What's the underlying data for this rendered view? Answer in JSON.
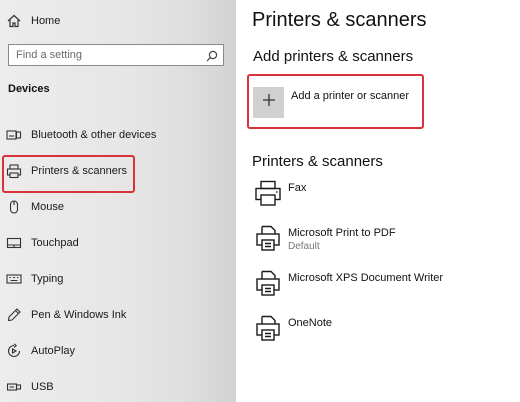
{
  "nav": {
    "home_label": "Home",
    "search_placeholder": "Find a setting",
    "section_label": "Devices",
    "items": [
      {
        "label": "Bluetooth & other devices",
        "icon": "bluetooth-devices-icon"
      },
      {
        "label": "Printers & scanners",
        "icon": "printer-icon",
        "selected": true
      },
      {
        "label": "Mouse",
        "icon": "mouse-icon"
      },
      {
        "label": "Touchpad",
        "icon": "touchpad-icon"
      },
      {
        "label": "Typing",
        "icon": "keyboard-icon"
      },
      {
        "label": "Pen & Windows Ink",
        "icon": "pen-icon"
      },
      {
        "label": "AutoPlay",
        "icon": "autoplay-icon"
      },
      {
        "label": "USB",
        "icon": "usb-icon"
      }
    ]
  },
  "main": {
    "title": "Printers & scanners",
    "add_section_title": "Add printers & scanners",
    "add_button_label": "Add a printer or scanner",
    "list_section_title": "Printers & scanners",
    "printers": [
      {
        "name": "Fax",
        "status": "",
        "icon": "fax-printer-icon"
      },
      {
        "name": "Microsoft Print to PDF",
        "status": "Default",
        "icon": "printer-icon"
      },
      {
        "name": "Microsoft XPS Document Writer",
        "status": "",
        "icon": "printer-icon"
      },
      {
        "name": "OneNote",
        "status": "",
        "icon": "printer-icon"
      }
    ]
  },
  "colors": {
    "highlight": "#d9323a",
    "add_tile": "#d0d0d0"
  }
}
